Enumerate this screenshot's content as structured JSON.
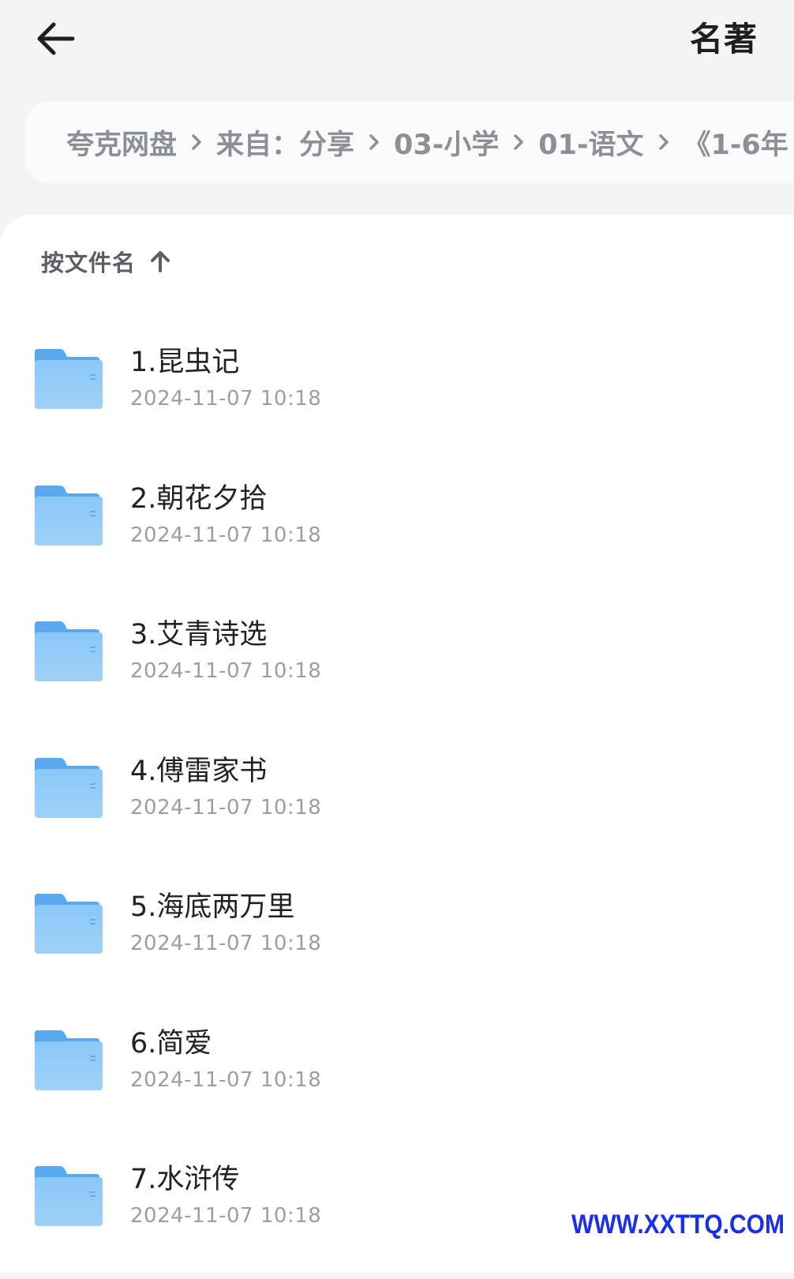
{
  "header": {
    "title": "名著"
  },
  "breadcrumb": [
    "夸克网盘",
    "来自：分享",
    "03-小学",
    "01-语文",
    "《1-6年"
  ],
  "sort": {
    "label": "按文件名",
    "direction": "ascending"
  },
  "files": [
    {
      "name": "1.昆虫记",
      "date": "2024-11-07 10:18"
    },
    {
      "name": "2.朝花夕拾",
      "date": "2024-11-07 10:18"
    },
    {
      "name": "3.艾青诗选",
      "date": "2024-11-07 10:18"
    },
    {
      "name": "4.傅雷家书",
      "date": "2024-11-07 10:18"
    },
    {
      "name": "5.海底两万里",
      "date": "2024-11-07 10:18"
    },
    {
      "name": "6.简爱",
      "date": "2024-11-07 10:18"
    },
    {
      "name": "7.水浒传",
      "date": "2024-11-07 10:18"
    }
  ],
  "watermark": "WWW.XXTTQ.COM",
  "colors": {
    "background": "#f4f4f5",
    "folder": "#7fbff4",
    "watermark": "#1a2fe8"
  }
}
